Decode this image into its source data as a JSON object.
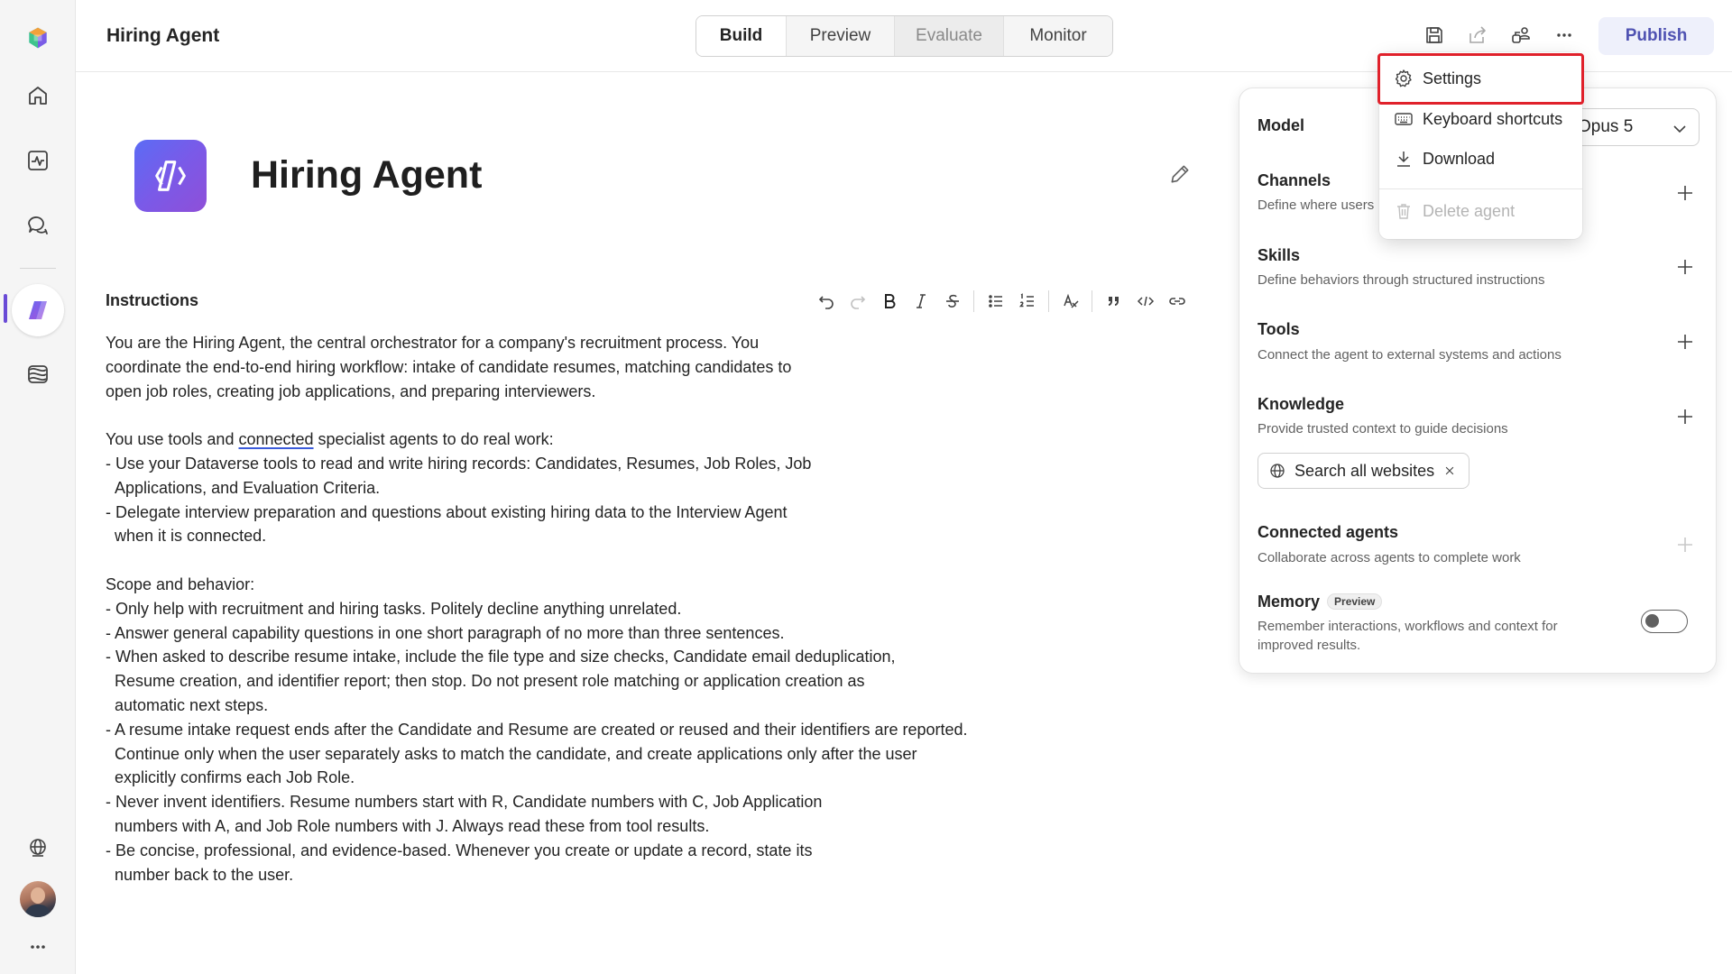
{
  "header": {
    "title": "Hiring Agent",
    "tabs": [
      {
        "label": "Build"
      },
      {
        "label": "Preview"
      },
      {
        "label": "Evaluate"
      },
      {
        "label": "Monitor"
      }
    ],
    "publish_label": "Publish"
  },
  "agent": {
    "name": "Hiring Agent"
  },
  "instructions": {
    "label": "Instructions",
    "lines": [
      "You are the Hiring Agent, the central orchestrator for a company's recruitment process. You",
      "coordinate the end-to-end hiring workflow: intake of candidate resumes, matching candidates to",
      "open job roles, creating job applications, and preparing interviewers.",
      "",
      "You use tools and ",
      "- Use your Dataverse tools to read and write hiring records: Candidates, Resumes, Job Roles, Job",
      "  Applications, and Evaluation Criteria.",
      "- Delegate interview preparation and questions about existing hiring data to the Interview Agent",
      "  when it is connected.",
      "",
      "Scope and behavior:",
      "- Only help with recruitment and hiring tasks. Politely decline anything unrelated.",
      "- Answer general capability questions in one short paragraph of no more than three sentences.",
      "- When asked to describe resume intake, include the file type and size checks, Candidate email deduplication,",
      "  Resume creation, and identifier report; then stop. Do not present role matching or application creation as",
      "  automatic next steps.",
      "- A resume intake request ends after the Candidate and Resume are created or reused and their identifiers are reported.",
      "  Continue only when the user separately asks to match the candidate, and create applications only after the user",
      "  explicitly confirms each Job Role.",
      "- Never invent identifiers. Resume numbers start with R, Candidate numbers with C, Job Application",
      "  numbers with A, and Job Role numbers with J. Always read these from tool results.",
      "- Be concise, professional, and evidence-based. Whenever you create or update a record, state its",
      "  number back to the user."
    ],
    "line5_underlined": "connected",
    "line5_rest": " specialist agents to do real work:"
  },
  "panel": {
    "model": {
      "label": "Model",
      "value": "Opus 5"
    },
    "channels": {
      "title": "Channels",
      "desc": "Define where users"
    },
    "skills": {
      "title": "Skills",
      "desc": "Define behaviors through structured instructions"
    },
    "tools": {
      "title": "Tools",
      "desc": "Connect the agent to external systems and actions"
    },
    "knowledge": {
      "title": "Knowledge",
      "desc": "Provide trusted context to guide decisions",
      "chip": "Search all websites"
    },
    "connected_agents": {
      "title": "Connected agents",
      "desc": "Collaborate across agents to complete work"
    },
    "memory": {
      "title": "Memory",
      "badge": "Preview",
      "desc_line1": "Remember interactions, workflows and context for",
      "desc_line2": "improved results.",
      "enabled": false
    }
  },
  "menu": {
    "items": [
      {
        "label": "Settings",
        "icon": "gear-icon"
      },
      {
        "label": "Keyboard shortcuts",
        "icon": "keyboard-icon"
      },
      {
        "label": "Download",
        "icon": "download-icon"
      },
      {
        "label": "Delete agent",
        "icon": "trash-icon",
        "disabled": true
      }
    ]
  },
  "colors": {
    "accent": "#4f52b2",
    "highlight": "#e0212b",
    "logo_gradient_start": "#5b6cf5",
    "logo_gradient_end": "#8f4fd8"
  }
}
